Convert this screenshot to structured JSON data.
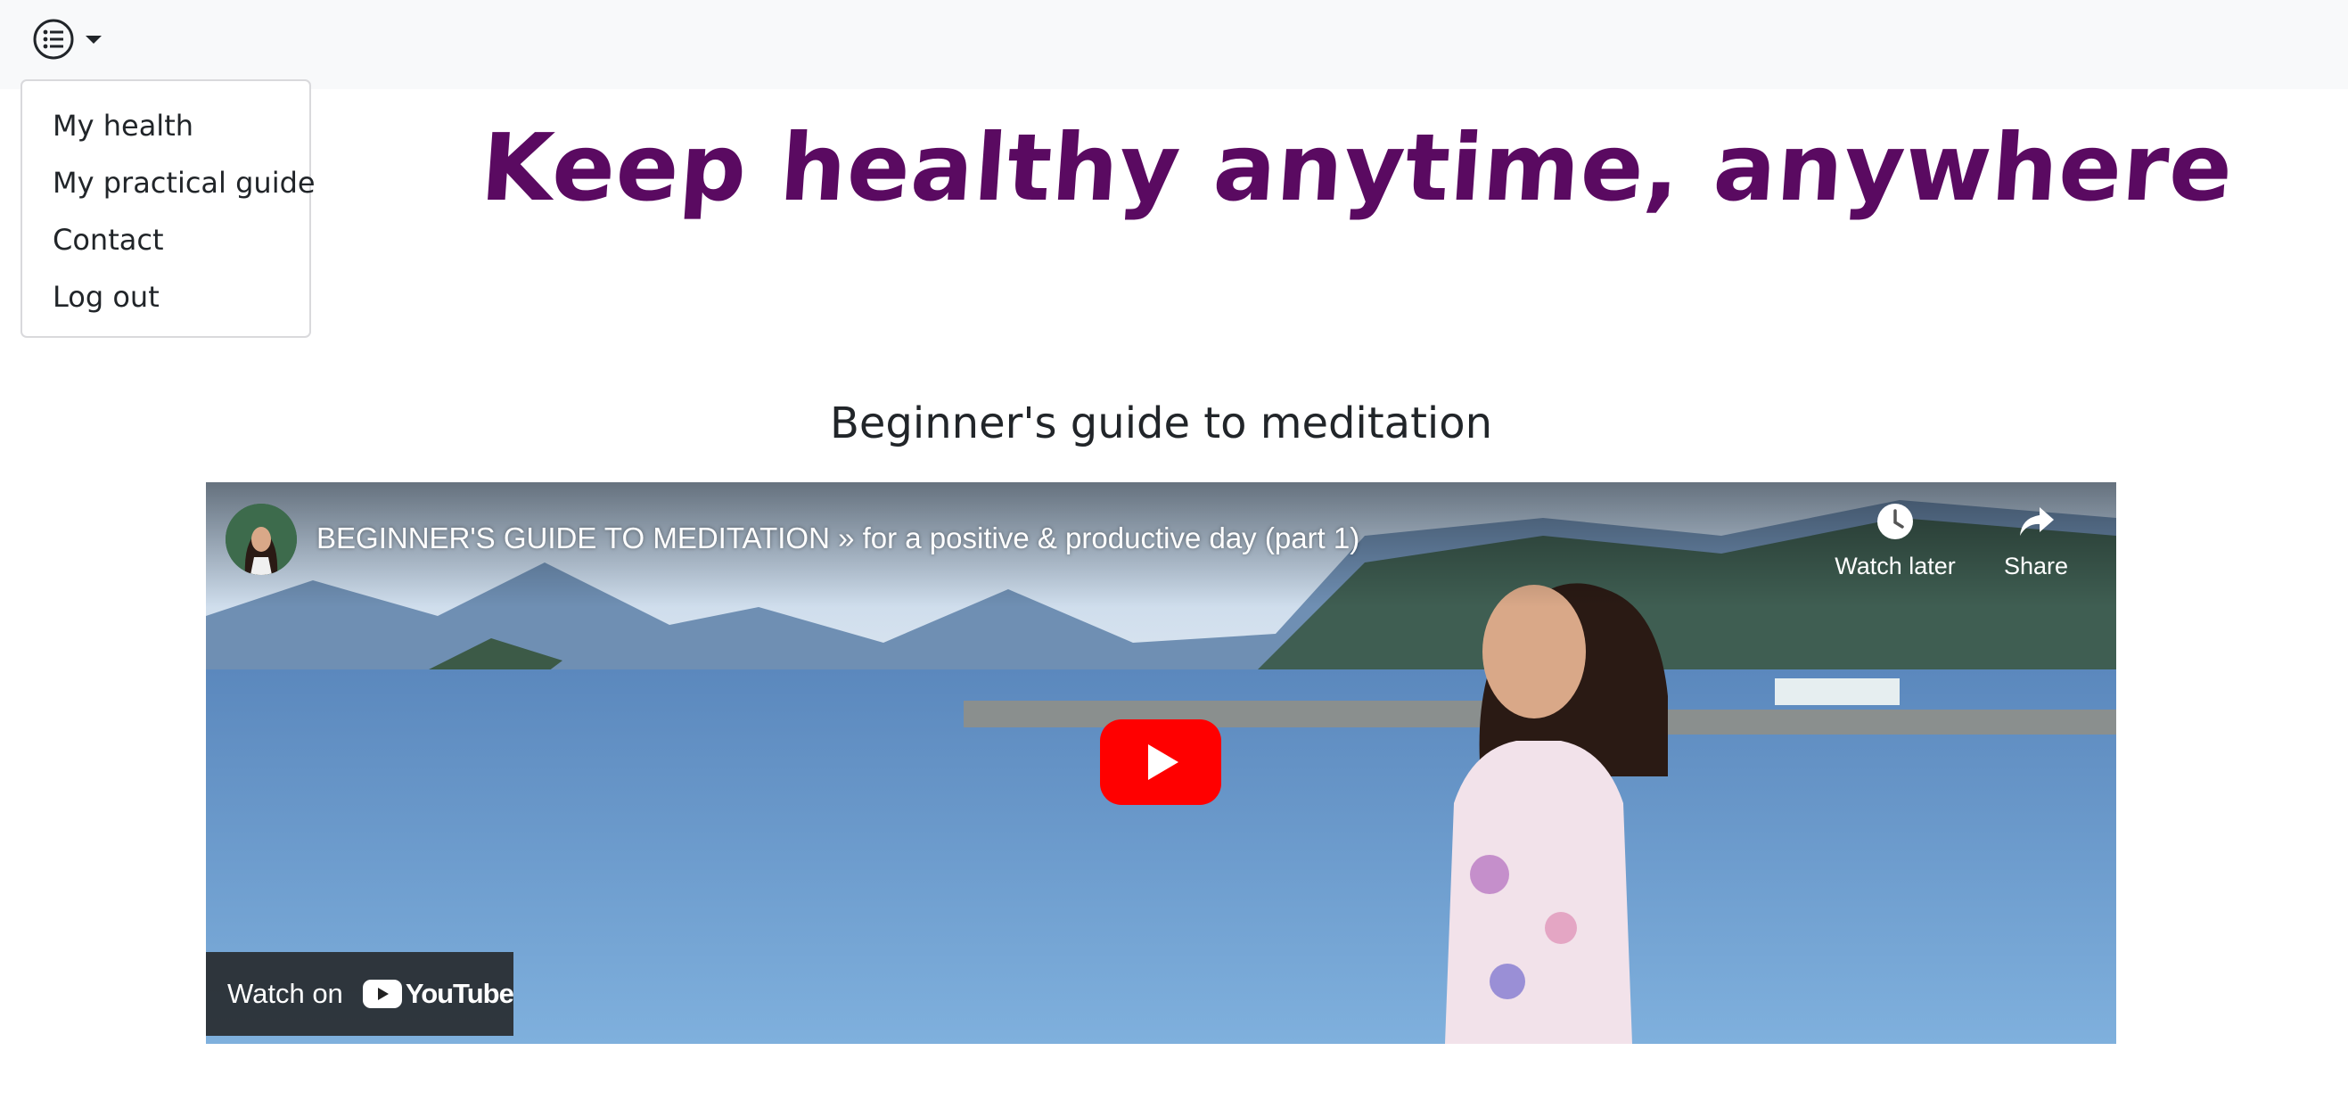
{
  "navbar": {
    "menu_icon": "list-icon",
    "caret_icon": "caret-down-icon",
    "dropdown_items": [
      {
        "label": "My health"
      },
      {
        "label": "My practical guide"
      },
      {
        "label": "Contact"
      },
      {
        "label": "Log out"
      }
    ]
  },
  "header": {
    "headline": "Keep healthy anytime, anywhere",
    "headline_color": "#5a0a61"
  },
  "section": {
    "title": "Beginner's guide to meditation"
  },
  "video": {
    "title": "BEGINNER'S GUIDE TO MEDITATION » for a positive & productive day (part 1)",
    "watch_later_label": "Watch later",
    "share_label": "Share",
    "watch_on_label": "Watch on",
    "youtube_logo_text": "YouTube",
    "play_icon": "play-icon",
    "brand_red": "#ff0000"
  }
}
